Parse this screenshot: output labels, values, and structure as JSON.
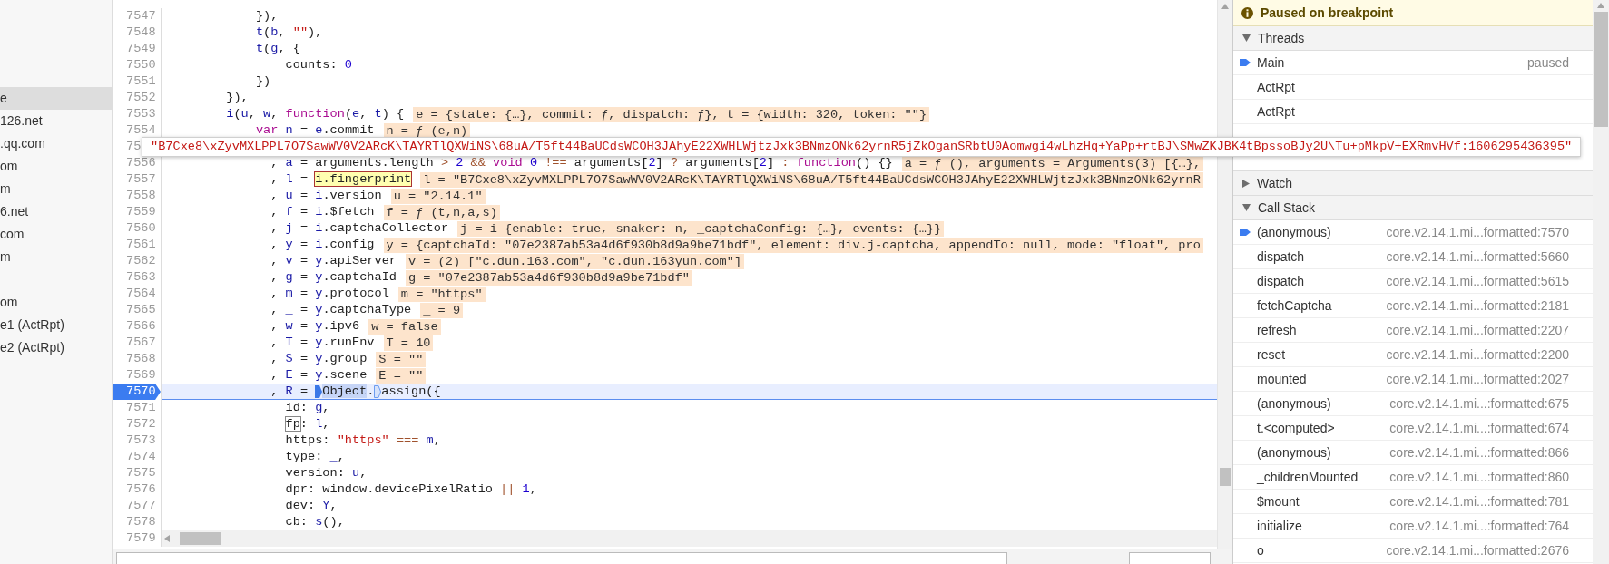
{
  "sidebar": {
    "groups": [
      {
        "items": [
          {
            "label": "e",
            "selected": true
          },
          {
            "label": "126.net",
            "selected": false
          },
          {
            "label": ".qq.com",
            "selected": false
          },
          {
            "label": "om",
            "selected": false
          },
          {
            "label": "m",
            "selected": false
          },
          {
            "label": "6.net",
            "selected": false
          },
          {
            "label": "com",
            "selected": false
          },
          {
            "label": "m",
            "selected": false
          }
        ]
      },
      {
        "items": [
          {
            "label": "om",
            "selected": false
          },
          {
            "label": "e1 (ActRpt)",
            "selected": false
          },
          {
            "label": "e2 (ActRpt)",
            "selected": false
          }
        ]
      }
    ]
  },
  "editor": {
    "tooltip": "\"B7Cxe8\\xZyvMXLPPL7O7SawWV0V2ARcK\\TAYRTlQXWiNS\\68uA/T5ft44BaUCdsWCOH3JAhyE22XWHLWjtzJxk3BNmzONk62yrnR5jZkOganSRbtU0Aomwgi4wLhzHq+YaPp+rtBJ\\SMwZKJBK4tBpssoBJy2U\\Tu+pMkpV+EXRmvHVf:1606295436395\"",
    "lines": [
      {
        "number": "7547",
        "current": false,
        "tokens": [
          {
            "text": "            }),",
            "kind": "plain"
          }
        ]
      },
      {
        "number": "7548",
        "current": false,
        "tokens": [
          {
            "text": "            t",
            "kind": "var"
          },
          {
            "text": "(",
            "kind": "plain"
          },
          {
            "text": "b",
            "kind": "var"
          },
          {
            "text": ", ",
            "kind": "plain"
          },
          {
            "text": "\"\"",
            "kind": "string"
          },
          {
            "text": "),",
            "kind": "plain"
          }
        ]
      },
      {
        "number": "7549",
        "current": false,
        "tokens": [
          {
            "text": "            t",
            "kind": "var"
          },
          {
            "text": "(",
            "kind": "plain"
          },
          {
            "text": "g",
            "kind": "var"
          },
          {
            "text": ", {",
            "kind": "plain"
          }
        ]
      },
      {
        "number": "7550",
        "current": false,
        "tokens": [
          {
            "text": "                counts: ",
            "kind": "plain"
          },
          {
            "text": "0",
            "kind": "number"
          }
        ]
      },
      {
        "number": "7551",
        "current": false,
        "tokens": [
          {
            "text": "            })",
            "kind": "plain"
          }
        ]
      },
      {
        "number": "7552",
        "current": false,
        "tokens": [
          {
            "text": "        }),",
            "kind": "plain"
          }
        ]
      },
      {
        "number": "7553",
        "current": false,
        "tokens": [
          {
            "text": "        i",
            "kind": "var"
          },
          {
            "text": "(",
            "kind": "plain"
          },
          {
            "text": "u",
            "kind": "var"
          },
          {
            "text": ", ",
            "kind": "plain"
          },
          {
            "text": "w",
            "kind": "var"
          },
          {
            "text": ", ",
            "kind": "plain"
          },
          {
            "text": "function",
            "kind": "keyword"
          },
          {
            "text": "(",
            "kind": "plain"
          },
          {
            "text": "e",
            "kind": "var"
          },
          {
            "text": ", ",
            "kind": "plain"
          },
          {
            "text": "t",
            "kind": "var"
          },
          {
            "text": ") {",
            "kind": "plain"
          }
        ],
        "inline": "e = {state: {…}, commit: ƒ, dispatch: ƒ}, t = {width: 320, token: \"\"}"
      },
      {
        "number": "7554",
        "current": false,
        "tokens": [
          {
            "text": "            var",
            "kind": "keyword"
          },
          {
            "text": " n",
            "kind": "var"
          },
          {
            "text": " = ",
            "kind": "plain"
          },
          {
            "text": "e",
            "kind": "var"
          },
          {
            "text": ".commit",
            "kind": "plain"
          }
        ],
        "inline": "n = ƒ (e,n)"
      },
      {
        "number": "75",
        "current": false
      },
      {
        "number": "7556",
        "current": false,
        "tokens": [
          {
            "text": "              , ",
            "kind": "plain"
          },
          {
            "text": "a",
            "kind": "var"
          },
          {
            "text": " = arguments.length ",
            "kind": "plain"
          },
          {
            "text": ">",
            "kind": "operator"
          },
          {
            "text": " 2 ",
            "kind": "number"
          },
          {
            "text": "&&",
            "kind": "operator"
          },
          {
            "text": " void",
            "kind": "keyword"
          },
          {
            "text": " 0 ",
            "kind": "number"
          },
          {
            "text": "!==",
            "kind": "operator"
          },
          {
            "text": " arguments[",
            "kind": "plain"
          },
          {
            "text": "2",
            "kind": "number"
          },
          {
            "text": "] ",
            "kind": "plain"
          },
          {
            "text": "?",
            "kind": "operator"
          },
          {
            "text": " arguments[",
            "kind": "plain"
          },
          {
            "text": "2",
            "kind": "number"
          },
          {
            "text": "] ",
            "kind": "plain"
          },
          {
            "text": ":",
            "kind": "operator"
          },
          {
            "text": " function",
            "kind": "keyword"
          },
          {
            "text": "() {}",
            "kind": "plain"
          }
        ],
        "inline": "a = ƒ (), arguments = Arguments(3) [{…},"
      },
      {
        "number": "7557",
        "current": false,
        "tokens": [
          {
            "text": "              , ",
            "kind": "plain"
          },
          {
            "text": "l",
            "kind": "var"
          },
          {
            "text": " = ",
            "kind": "plain"
          },
          {
            "text": "i.fingerprint",
            "kind": "hover"
          }
        ],
        "inline": "l = \"B7Cxe8\\xZyvMXLPPL7O7SawWV0V2ARcK\\TAYRTlQXWiNS\\68uA/T5ft44BaUCdsWCOH3JAhyE22XWHLWjtzJxk3BNmzONk62yrnR"
      },
      {
        "number": "7558",
        "current": false,
        "tokens": [
          {
            "text": "              , ",
            "kind": "plain"
          },
          {
            "text": "u",
            "kind": "var"
          },
          {
            "text": " = ",
            "kind": "plain"
          },
          {
            "text": "i",
            "kind": "var"
          },
          {
            "text": ".version",
            "kind": "plain"
          }
        ],
        "inline": "u = \"2.14.1\""
      },
      {
        "number": "7559",
        "current": false,
        "tokens": [
          {
            "text": "              , ",
            "kind": "plain"
          },
          {
            "text": "f",
            "kind": "var"
          },
          {
            "text": " = ",
            "kind": "plain"
          },
          {
            "text": "i",
            "kind": "var"
          },
          {
            "text": ".$fetch",
            "kind": "plain"
          }
        ],
        "inline": "f = ƒ (t,n,a,s)"
      },
      {
        "number": "7560",
        "current": false,
        "tokens": [
          {
            "text": "              , ",
            "kind": "plain"
          },
          {
            "text": "j",
            "kind": "var"
          },
          {
            "text": " = ",
            "kind": "plain"
          },
          {
            "text": "i",
            "kind": "var"
          },
          {
            "text": ".captchaCollector",
            "kind": "plain"
          }
        ],
        "inline": "j = i {enable: true, snaker: n, _captchaConfig: {…}, events: {…}}"
      },
      {
        "number": "7561",
        "current": false,
        "tokens": [
          {
            "text": "              , ",
            "kind": "plain"
          },
          {
            "text": "y",
            "kind": "var"
          },
          {
            "text": " = ",
            "kind": "plain"
          },
          {
            "text": "i",
            "kind": "var"
          },
          {
            "text": ".config",
            "kind": "plain"
          }
        ],
        "inline": "y = {captchaId: \"07e2387ab53a4d6f930b8d9a9be71bdf\", element: div.j-captcha, appendTo: null, mode: \"float\", pro"
      },
      {
        "number": "7562",
        "current": false,
        "tokens": [
          {
            "text": "              , ",
            "kind": "plain"
          },
          {
            "text": "v",
            "kind": "var"
          },
          {
            "text": " = ",
            "kind": "plain"
          },
          {
            "text": "y",
            "kind": "var"
          },
          {
            "text": ".apiServer",
            "kind": "plain"
          }
        ],
        "inline": "v = (2) [\"c.dun.163.com\", \"c.dun.163yun.com\"]"
      },
      {
        "number": "7563",
        "current": false,
        "tokens": [
          {
            "text": "              , ",
            "kind": "plain"
          },
          {
            "text": "g",
            "kind": "var"
          },
          {
            "text": " = ",
            "kind": "plain"
          },
          {
            "text": "y",
            "kind": "var"
          },
          {
            "text": ".captchaId",
            "kind": "plain"
          }
        ],
        "inline": "g = \"07e2387ab53a4d6f930b8d9a9be71bdf\""
      },
      {
        "number": "7564",
        "current": false,
        "tokens": [
          {
            "text": "              , ",
            "kind": "plain"
          },
          {
            "text": "m",
            "kind": "var"
          },
          {
            "text": " = ",
            "kind": "plain"
          },
          {
            "text": "y",
            "kind": "var"
          },
          {
            "text": ".protocol",
            "kind": "plain"
          }
        ],
        "inline": "m = \"https\""
      },
      {
        "number": "7565",
        "current": false,
        "tokens": [
          {
            "text": "              , ",
            "kind": "plain"
          },
          {
            "text": "_",
            "kind": "var"
          },
          {
            "text": " = ",
            "kind": "plain"
          },
          {
            "text": "y",
            "kind": "var"
          },
          {
            "text": ".captchaType",
            "kind": "plain"
          }
        ],
        "inline": "_ = 9"
      },
      {
        "number": "7566",
        "current": false,
        "tokens": [
          {
            "text": "              , ",
            "kind": "plain"
          },
          {
            "text": "w",
            "kind": "var"
          },
          {
            "text": " = ",
            "kind": "plain"
          },
          {
            "text": "y",
            "kind": "var"
          },
          {
            "text": ".ipv6",
            "kind": "plain"
          }
        ],
        "inline": "w = false"
      },
      {
        "number": "7567",
        "current": false,
        "tokens": [
          {
            "text": "              , ",
            "kind": "plain"
          },
          {
            "text": "T",
            "kind": "var"
          },
          {
            "text": " = ",
            "kind": "plain"
          },
          {
            "text": "y",
            "kind": "var"
          },
          {
            "text": ".runEnv",
            "kind": "plain"
          }
        ],
        "inline": "T = 10"
      },
      {
        "number": "7568",
        "current": false,
        "tokens": [
          {
            "text": "              , ",
            "kind": "plain"
          },
          {
            "text": "S",
            "kind": "var"
          },
          {
            "text": " = ",
            "kind": "plain"
          },
          {
            "text": "y",
            "kind": "var"
          },
          {
            "text": ".group",
            "kind": "plain"
          }
        ],
        "inline": "S = \"\""
      },
      {
        "number": "7569",
        "current": false,
        "tokens": [
          {
            "text": "              , ",
            "kind": "plain"
          },
          {
            "text": "E",
            "kind": "var"
          },
          {
            "text": " = ",
            "kind": "plain"
          },
          {
            "text": "y",
            "kind": "var"
          },
          {
            "text": ".scene",
            "kind": "plain"
          }
        ],
        "inline": "E = \"\""
      },
      {
        "number": "7570",
        "current": true,
        "tokens": [
          {
            "text": "              , ",
            "kind": "plain"
          },
          {
            "text": "R",
            "kind": "var"
          },
          {
            "text": " = ",
            "kind": "plain"
          },
          {
            "kind": "breakpoint",
            "active": true
          },
          {
            "text": "Object",
            "kind": "selected"
          },
          {
            "text": ".",
            "kind": "plain"
          },
          {
            "kind": "breakpoint",
            "active": false
          },
          {
            "text": "assign({",
            "kind": "plain"
          }
        ]
      },
      {
        "number": "7571",
        "current": false,
        "tokens": [
          {
            "text": "                id: ",
            "kind": "plain"
          },
          {
            "text": "g",
            "kind": "var"
          },
          {
            "text": ",",
            "kind": "plain"
          }
        ]
      },
      {
        "number": "7572",
        "current": false,
        "tokens": [
          {
            "text": "                fp",
            "kind": "boxed"
          },
          {
            "text": ": ",
            "kind": "plain"
          },
          {
            "text": "l",
            "kind": "var"
          },
          {
            "text": ",",
            "kind": "plain"
          }
        ]
      },
      {
        "number": "7573",
        "current": false,
        "tokens": [
          {
            "text": "                https: ",
            "kind": "plain"
          },
          {
            "text": "\"https\"",
            "kind": "string"
          },
          {
            "text": " === ",
            "kind": "operator"
          },
          {
            "text": "m",
            "kind": "var"
          },
          {
            "text": ",",
            "kind": "plain"
          }
        ]
      },
      {
        "number": "7574",
        "current": false,
        "tokens": [
          {
            "text": "                type: ",
            "kind": "plain"
          },
          {
            "text": "_",
            "kind": "var"
          },
          {
            "text": ",",
            "kind": "plain"
          }
        ]
      },
      {
        "number": "7575",
        "current": false,
        "tokens": [
          {
            "text": "                version: ",
            "kind": "plain"
          },
          {
            "text": "u",
            "kind": "var"
          },
          {
            "text": ",",
            "kind": "plain"
          }
        ]
      },
      {
        "number": "7576",
        "current": false,
        "tokens": [
          {
            "text": "                dpr: window.devicePixelRatio ",
            "kind": "plain"
          },
          {
            "text": "||",
            "kind": "operator"
          },
          {
            "text": " 1",
            "kind": "number"
          },
          {
            "text": ",",
            "kind": "plain"
          }
        ]
      },
      {
        "number": "7577",
        "current": false,
        "tokens": [
          {
            "text": "                dev: ",
            "kind": "plain"
          },
          {
            "text": "Y",
            "kind": "var"
          },
          {
            "text": ",",
            "kind": "plain"
          }
        ]
      },
      {
        "number": "7578",
        "current": false,
        "tokens": [
          {
            "text": "                cb: ",
            "kind": "plain"
          },
          {
            "text": "s",
            "kind": "var"
          },
          {
            "text": "(),",
            "kind": "plain"
          }
        ]
      },
      {
        "number": "7579",
        "current": false
      }
    ]
  },
  "debugger": {
    "banner": "Paused on breakpoint",
    "sections": [
      {
        "title": "Threads",
        "kind": "threads",
        "expanded": true,
        "rows": [
          {
            "name": "Main",
            "status": "paused",
            "current": true
          },
          {
            "name": "ActRpt",
            "current": false
          },
          {
            "name": "ActRpt",
            "current": false
          }
        ]
      },
      {
        "title": "Watch",
        "kind": "watch",
        "expanded": false
      },
      {
        "title": "Call Stack",
        "kind": "callstack",
        "expanded": true,
        "rows": [
          {
            "name": "(anonymous)",
            "location": "core.v2.14.1.mi...formatted:7570",
            "current": true
          },
          {
            "name": "dispatch",
            "location": "core.v2.14.1.mi...formatted:5660",
            "current": false
          },
          {
            "name": "dispatch",
            "location": "core.v2.14.1.mi...formatted:5615",
            "current": false
          },
          {
            "name": "fetchCaptcha",
            "location": "core.v2.14.1.mi...formatted:2181",
            "current": false
          },
          {
            "name": "refresh",
            "location": "core.v2.14.1.mi...formatted:2207",
            "current": false
          },
          {
            "name": "reset",
            "location": "core.v2.14.1.mi...formatted:2200",
            "current": false
          },
          {
            "name": "mounted",
            "location": "core.v2.14.1.mi...formatted:2027",
            "current": false
          },
          {
            "name": "(anonymous)",
            "location": "core.v2.14.1.mi...:formatted:675",
            "current": false
          },
          {
            "name": "t.<computed>",
            "location": "core.v2.14.1.mi...:formatted:674",
            "current": false
          },
          {
            "name": "(anonymous)",
            "location": "core.v2.14.1.mi...:formatted:866",
            "current": false
          },
          {
            "name": "_childrenMounted",
            "location": "core.v2.14.1.mi...:formatted:860",
            "current": false
          },
          {
            "name": "$mount",
            "location": "core.v2.14.1.mi...:formatted:781",
            "current": false
          },
          {
            "name": "initialize",
            "location": "core.v2.14.1.mi...:formatted:764",
            "current": false
          },
          {
            "name": "o",
            "location": "core.v2.14.1.mi...formatted:2676",
            "current": false
          }
        ]
      }
    ]
  }
}
